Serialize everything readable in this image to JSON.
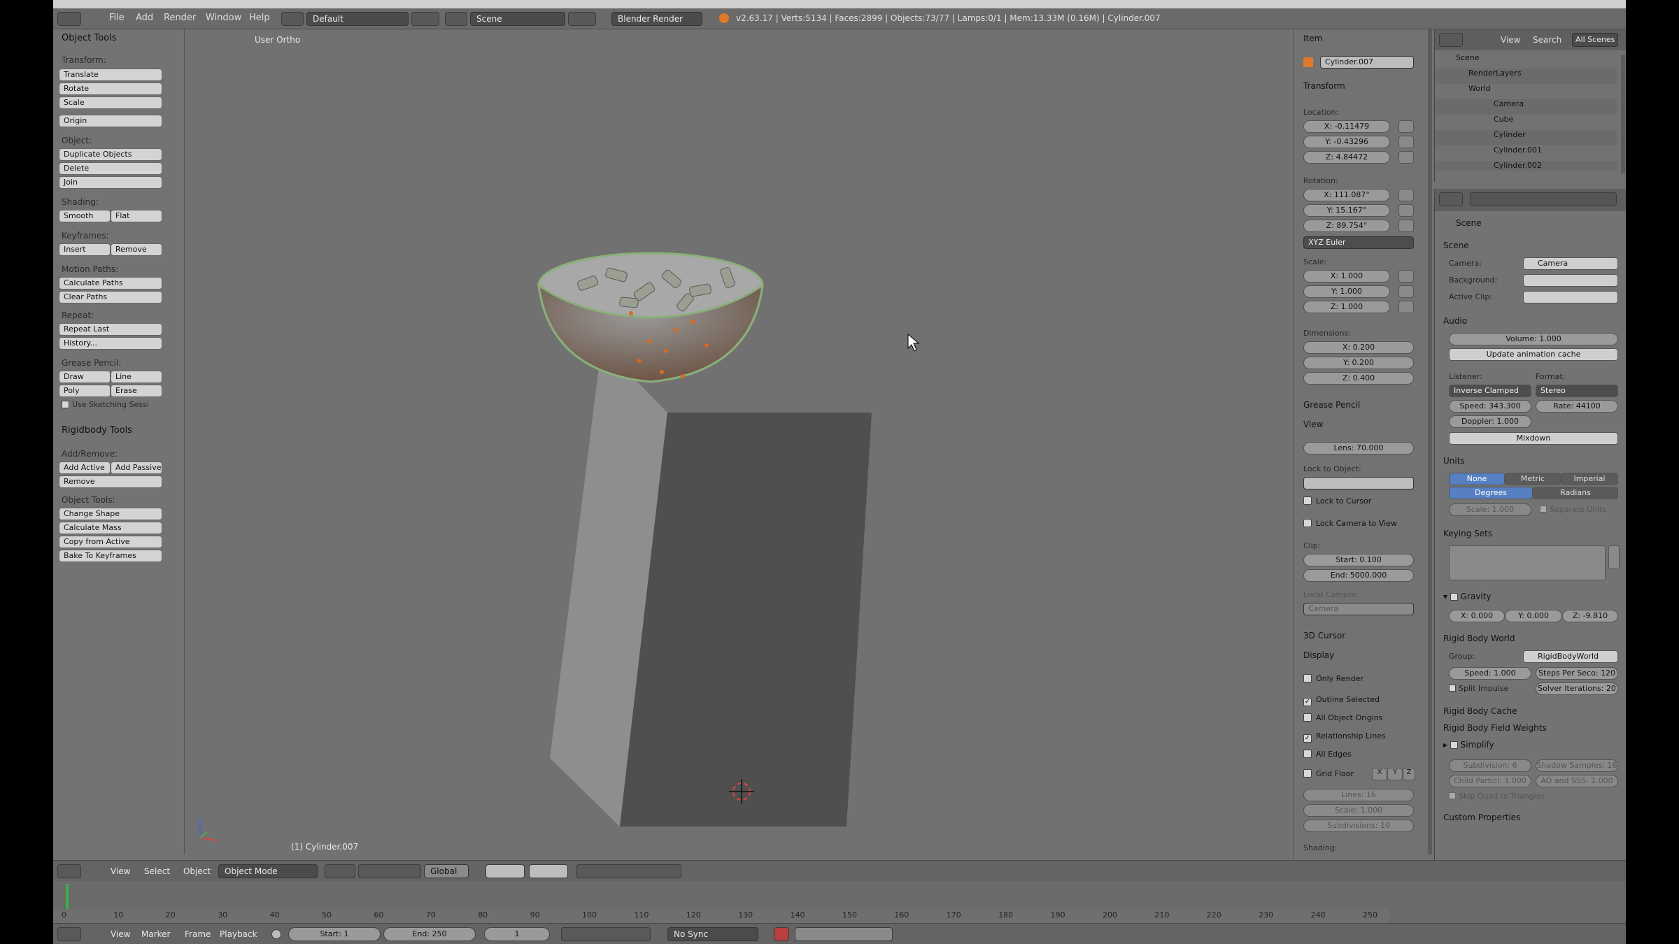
{
  "info_header": {
    "menus": [
      "File",
      "Add",
      "Render",
      "Window",
      "Help"
    ],
    "screen_layout": "Default",
    "scene": "Scene",
    "render_engine": "Blender Render",
    "stats": "v2.63.17 | Verts:5134 | Faces:2899 | Objects:73/77 | Lamps:0/1 | Mem:13.33M (0.16M) | Cylinder.007"
  },
  "tool_shelf": {
    "title": "Object Tools",
    "transform_label": "Transform:",
    "translate": "Translate",
    "rotate": "Rotate",
    "scale": "Scale",
    "origin": "Origin",
    "object_label": "Object:",
    "duplicate_objects": "Duplicate Objects",
    "delete": "Delete",
    "join": "Join",
    "shading_label": "Shading:",
    "smooth": "Smooth",
    "flat": "Flat",
    "keyframes_label": "Keyframes:",
    "insert": "Insert",
    "remove": "Remove",
    "motion_paths_label": "Motion Paths:",
    "calculate_paths": "Calculate Paths",
    "clear_paths": "Clear Paths",
    "repeat_label": "Repeat:",
    "repeat_last": "Repeat Last",
    "history": "History...",
    "grease_pencil_label": "Grease Pencil:",
    "draw": "Draw",
    "line": "Line",
    "poly": "Poly",
    "erase": "Erase",
    "use_sketching_session": "Use Sketching Sessi",
    "rigidbody_title": "Rigidbody Tools",
    "add_remove_label": "Add/Remove:",
    "add_active": "Add Active",
    "add_passive": "Add Passive",
    "rb_remove": "Remove",
    "object_tools_label": "Object Tools:",
    "change_shape": "Change Shape",
    "calculate_mass": "Calculate Mass",
    "copy_from_active": "Copy from Active",
    "bake_to_keyframes": "Bake To Keyframes"
  },
  "viewport": {
    "view_label": "User Ortho",
    "object_label": "(1) Cylinder.007"
  },
  "n_panel": {
    "item_title": "Item",
    "object_name": "Cylinder.007",
    "transform_title": "Transform",
    "location_label": "Location:",
    "loc_x": "X: -0.11479",
    "loc_y": "Y: -0.43296",
    "loc_z": "Z: 4.84472",
    "rotation_label": "Rotation:",
    "rot_x": "X: 111.087°",
    "rot_y": "Y: 15.167°",
    "rot_z": "Z: 89.754°",
    "rotation_mode": "XYZ Euler",
    "scale_label": "Scale:",
    "scale_x": "X: 1.000",
    "scale_y": "Y: 1.000",
    "scale_z": "Z: 1.000",
    "dimensions_label": "Dimensions:",
    "dim_x": "X: 0.200",
    "dim_y": "Y: 0.200",
    "dim_z": "Z: 0.400",
    "grease_pencil_title": "Grease Pencil",
    "view_title": "View",
    "lens": "Lens: 70.000",
    "lock_to_object_label": "Lock to Object:",
    "lock_to_cursor": "Lock to Cursor",
    "lock_camera_to_view": "Lock Camera to View",
    "clip_label": "Clip:",
    "clip_start": "Start: 0.100",
    "clip_end": "End: 5000.000",
    "local_camera_label": "Local Camera:",
    "local_camera": "Camera",
    "cursor_title": "3D Cursor",
    "display_title": "Display",
    "only_render": "Only Render",
    "outline_selected": "Outline Selected",
    "all_object_origins": "All Object Origins",
    "relationship_lines": "Relationship Lines",
    "all_edges": "All Edges",
    "grid_floor": "Grid Floor",
    "grid_x": "X",
    "grid_y": "Y",
    "grid_z": "Z",
    "lines": "Lines: 16",
    "grid_scale": "Scale: 1.000",
    "subdivisions": "Subdivisions: 10",
    "shading_label": "Shading:"
  },
  "outliner": {
    "view": "View",
    "search": "Search",
    "filter": "All Scenes",
    "rows": [
      "Scene",
      "RenderLayers",
      "World",
      "Camera",
      "Cube",
      "Cylinder",
      "Cylinder.001",
      "Cylinder.002"
    ]
  },
  "properties": {
    "context": "Scene",
    "scene_title": "Scene",
    "camera_label": "Camera:",
    "camera": "Camera",
    "background_label": "Background:",
    "active_clip_label": "Active Clip:",
    "audio_title": "Audio",
    "volume": "Volume: 1.000",
    "update_cache": "Update animation cache",
    "listener_label": "Listener:",
    "listener": "Inverse Clamped",
    "format_label": "Format:",
    "format": "Stereo",
    "speed": "Speed: 343.300",
    "rate": "Rate: 44100",
    "doppler": "Doppler: 1.000",
    "mixdown": "Mixdown",
    "units_title": "Units",
    "none": "None",
    "metric": "Metric",
    "imperial": "Imperial",
    "degrees": "Degrees",
    "radians": "Radians",
    "unit_scale": "Scale: 1.000",
    "separate_units": "Separate Units",
    "keying_sets_title": "Keying Sets",
    "gravity_title": "Gravity",
    "gx": "X: 0.000",
    "gy": "Y: 0.000",
    "gz": "Z: -9.810",
    "rbw_title": "Rigid Body World",
    "group_label": "Group:",
    "group": "RigidBodyWorld",
    "rb_speed": "Speed: 1.000",
    "steps": "Steps Per Seco: 120",
    "split_impulse": "Split Impulse",
    "solver": "Solver Iterations: 20",
    "rb_cache": "Rigid Body Cache",
    "rb_field": "Rigid Body Field Weights",
    "simplify": "Simplify",
    "subdivision": "Subdivision: 6",
    "shadow_samples": "Shadow Samples: 16",
    "child_particles": "Child Particl: 1.000",
    "ao_sss": "AO and SSS: 1.000",
    "skip_quad": "Skip Quad to Triangles",
    "custom_props": "Custom Properties"
  },
  "view3d_header": {
    "view": "View",
    "select": "Select",
    "object": "Object",
    "mode": "Object Mode",
    "orientation": "Global"
  },
  "timeline": {
    "ticks": [
      "0",
      "10",
      "20",
      "30",
      "40",
      "50",
      "60",
      "70",
      "80",
      "90",
      "100",
      "110",
      "120",
      "130",
      "140",
      "150",
      "160",
      "170",
      "180",
      "190",
      "200",
      "210",
      "220",
      "230",
      "240",
      "250"
    ],
    "view": "View",
    "marker": "Marker",
    "frame": "Frame",
    "playback": "Playback",
    "start": "Start: 1",
    "end": "End: 250",
    "current": "1",
    "sync": "No Sync"
  }
}
